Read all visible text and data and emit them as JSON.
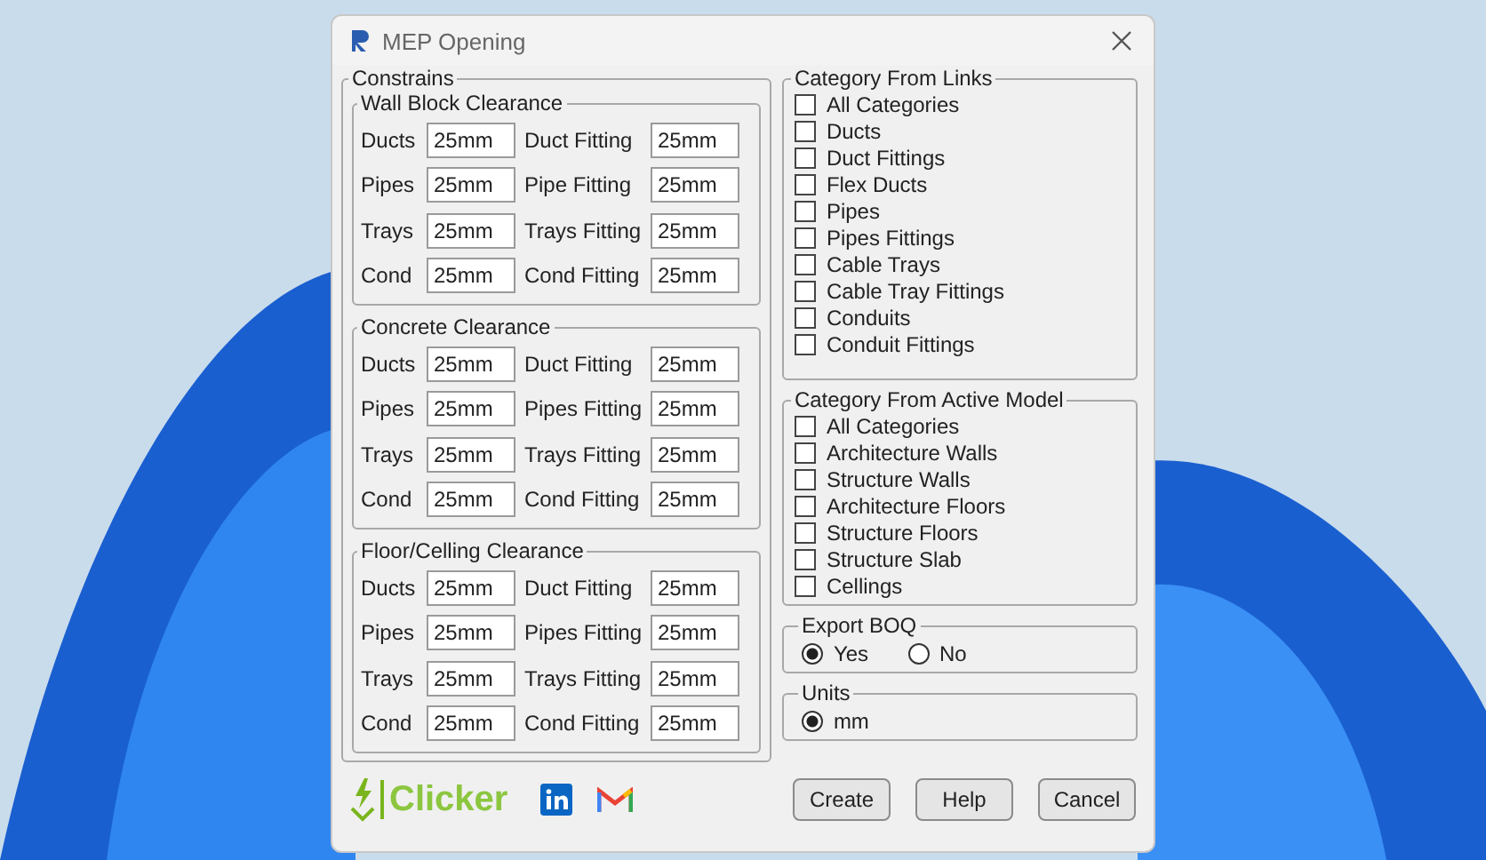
{
  "window": {
    "title": "MEP Opening"
  },
  "constrains": {
    "legend": "Constrains",
    "groups": [
      {
        "legend": "Wall Block Clearance",
        "rows": [
          {
            "label": "Ducts",
            "value": "25mm",
            "fitting_label": "Duct Fitting",
            "fitting_value": "25mm"
          },
          {
            "label": "Pipes",
            "value": "25mm",
            "fitting_label": "Pipe Fitting",
            "fitting_value": "25mm"
          },
          {
            "label": "Trays",
            "value": "25mm",
            "fitting_label": "Trays Fitting",
            "fitting_value": "25mm"
          },
          {
            "label": "Cond",
            "value": "25mm",
            "fitting_label": "Cond Fitting",
            "fitting_value": "25mm"
          }
        ]
      },
      {
        "legend": "Concrete Clearance",
        "rows": [
          {
            "label": "Ducts",
            "value": "25mm",
            "fitting_label": "Duct Fitting",
            "fitting_value": "25mm"
          },
          {
            "label": "Pipes",
            "value": "25mm",
            "fitting_label": "Pipes Fitting",
            "fitting_value": "25mm"
          },
          {
            "label": "Trays",
            "value": "25mm",
            "fitting_label": "Trays Fitting",
            "fitting_value": "25mm"
          },
          {
            "label": "Cond",
            "value": "25mm",
            "fitting_label": "Cond Fitting",
            "fitting_value": "25mm"
          }
        ]
      },
      {
        "legend": "Floor/Celling Clearance",
        "rows": [
          {
            "label": "Ducts",
            "value": "25mm",
            "fitting_label": "Duct Fitting",
            "fitting_value": "25mm"
          },
          {
            "label": "Pipes",
            "value": "25mm",
            "fitting_label": "Pipes Fitting",
            "fitting_value": "25mm"
          },
          {
            "label": "Trays",
            "value": "25mm",
            "fitting_label": "Trays Fitting",
            "fitting_value": "25mm"
          },
          {
            "label": "Cond",
            "value": "25mm",
            "fitting_label": "Cond Fitting",
            "fitting_value": "25mm"
          }
        ]
      }
    ]
  },
  "category_from_links": {
    "legend": "Category From Links",
    "items": [
      {
        "label": "All Categories",
        "checked": false
      },
      {
        "label": "Ducts",
        "checked": false
      },
      {
        "label": "Duct Fittings",
        "checked": false
      },
      {
        "label": "Flex Ducts",
        "checked": false
      },
      {
        "label": "Pipes",
        "checked": false
      },
      {
        "label": "Pipes Fittings",
        "checked": false
      },
      {
        "label": "Cable Trays",
        "checked": false
      },
      {
        "label": "Cable Tray Fittings",
        "checked": false
      },
      {
        "label": "Conduits",
        "checked": false
      },
      {
        "label": "Conduit Fittings",
        "checked": false
      }
    ]
  },
  "category_from_active_model": {
    "legend": "Category From Active Model",
    "items": [
      {
        "label": "All Categories",
        "checked": false
      },
      {
        "label": "Architecture Walls",
        "checked": false
      },
      {
        "label": "Structure Walls",
        "checked": false
      },
      {
        "label": "Architecture Floors",
        "checked": false
      },
      {
        "label": "Structure Floors",
        "checked": false
      },
      {
        "label": "Structure Slab",
        "checked": false
      },
      {
        "label": "Cellings",
        "checked": false
      }
    ]
  },
  "export_boq": {
    "legend": "Export BOQ",
    "options": [
      {
        "label": "Yes",
        "selected": true
      },
      {
        "label": "No",
        "selected": false
      }
    ]
  },
  "units": {
    "legend": "Units",
    "options": [
      {
        "label": "mm",
        "selected": true
      }
    ]
  },
  "footer": {
    "brand": "Clicker",
    "buttons": [
      "Create",
      "Help",
      "Cancel"
    ]
  }
}
